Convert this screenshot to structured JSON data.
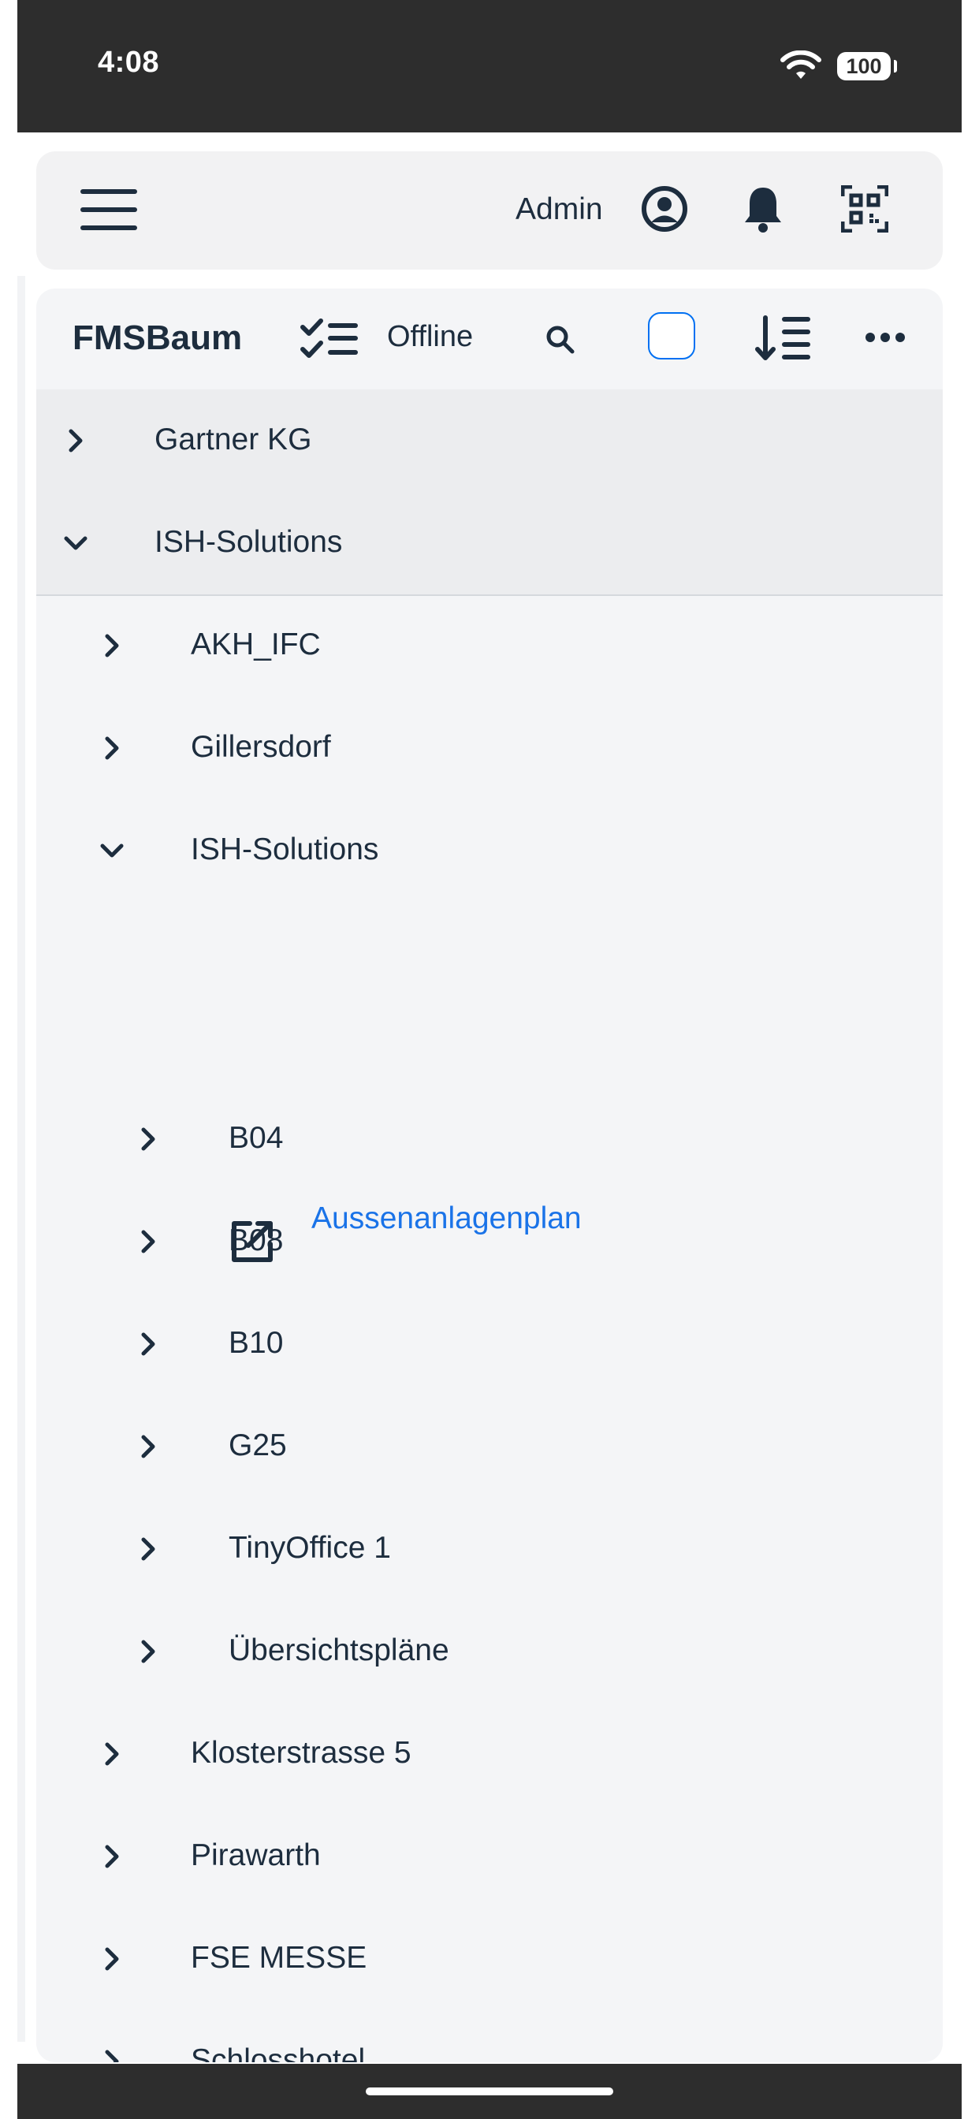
{
  "status_bar": {
    "time": "4:08",
    "battery": "100"
  },
  "shell": {
    "menu_icon": "hamburger-icon",
    "user_label": "Admin",
    "icons": [
      "user-circle-icon",
      "bell-icon",
      "qr-code-icon"
    ]
  },
  "toolbar": {
    "title": "FMSBaum",
    "offline_label": "Offline",
    "icons": [
      "checklist-icon",
      "search-icon",
      "sort-icon",
      "more-icon"
    ],
    "accent": "#0070f2"
  },
  "tree": {
    "items": [
      {
        "label": "Gartner KG",
        "level": 0,
        "expanded": false
      },
      {
        "label": "ISH-Solutions",
        "level": 0,
        "expanded": true
      },
      {
        "label": "AKH_IFC",
        "level": 1,
        "expanded": false
      },
      {
        "label": "Gillersdorf",
        "level": 1,
        "expanded": false
      },
      {
        "label": "ISH-Solutions",
        "level": 1,
        "expanded": true
      },
      {
        "label": "B04",
        "level": 2,
        "expanded": false
      },
      {
        "label": "B08",
        "level": 2,
        "expanded": false
      },
      {
        "label": "B10",
        "level": 2,
        "expanded": false
      },
      {
        "label": "G25",
        "level": 2,
        "expanded": false
      },
      {
        "label": "TinyOffice 1",
        "level": 2,
        "expanded": false
      },
      {
        "label": "Übersichtspläne",
        "level": 2,
        "expanded": false
      },
      {
        "label": "Klosterstrasse 5",
        "level": 1,
        "expanded": false
      },
      {
        "label": "Pirawarth",
        "level": 1,
        "expanded": false
      },
      {
        "label": "FSE MESSE",
        "level": 1,
        "expanded": false
      },
      {
        "label": "Schlosshotel",
        "level": 1,
        "expanded": false
      }
    ],
    "link": {
      "label": "Aussenanlagenplan",
      "icon": "external-link-icon",
      "color": "#1a73e8"
    }
  }
}
